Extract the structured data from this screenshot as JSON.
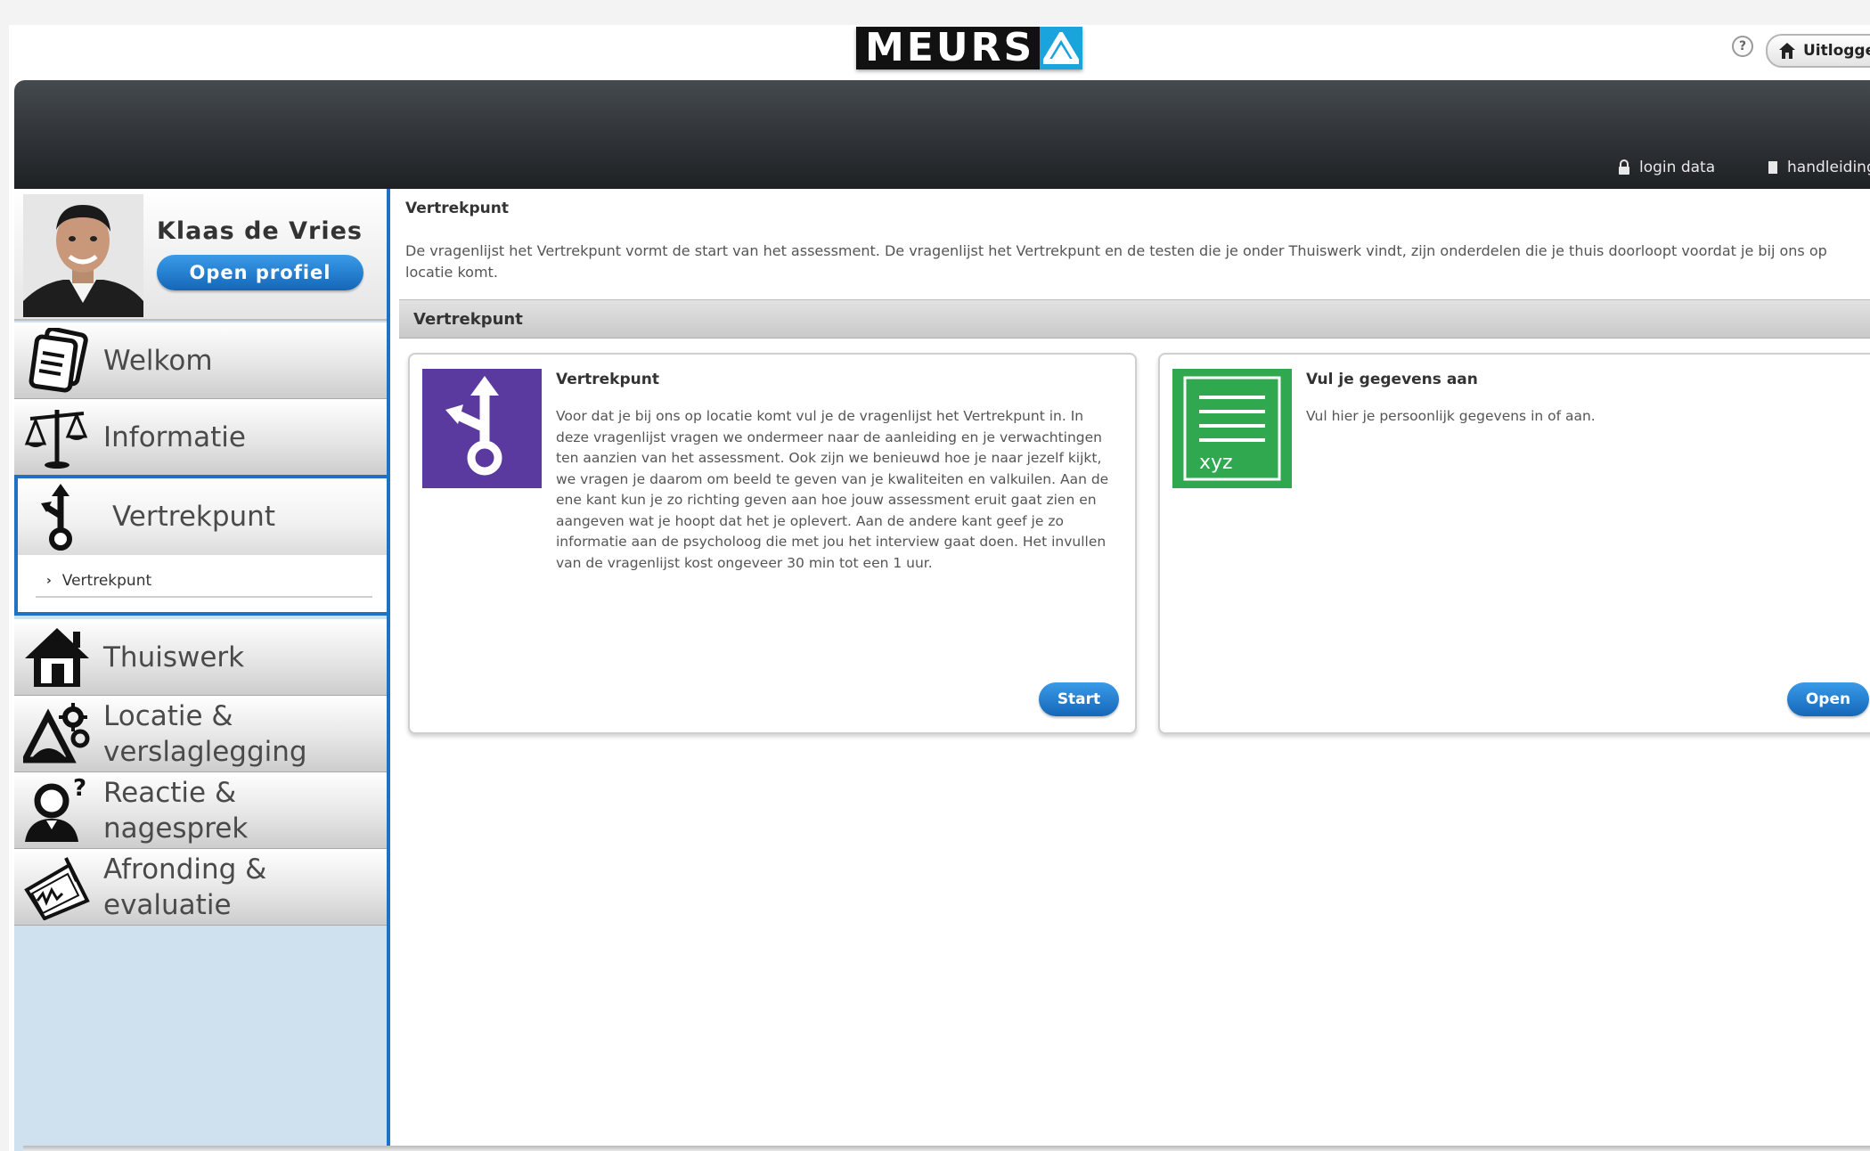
{
  "header": {
    "logo_text": "MEURS",
    "help_glyph": "?",
    "logout_label": "Uitloggen",
    "colors": {
      "logo_accent": "#1aa3dc",
      "topbar": "#2f3337",
      "accent_blue": "#1f71c2"
    }
  },
  "topbar": {
    "links": [
      {
        "label": "login data",
        "icon": "lock-icon"
      },
      {
        "label": "handleiding",
        "icon": "document-icon"
      }
    ]
  },
  "profile": {
    "name": "Klaas de  Vries",
    "button_label": "Open profiel"
  },
  "sidebar": {
    "items": [
      {
        "label": "Welkom",
        "icon": "documents-icon"
      },
      {
        "label": "Informatie",
        "icon": "scales-icon"
      },
      {
        "label": "Vertrekpunt",
        "icon": "signpost-icon"
      },
      {
        "label": "Thuiswerk",
        "icon": "house-icon"
      },
      {
        "label": "Locatie & verslaglegging",
        "icon": "location-gear-icon"
      },
      {
        "label": "Reactie & nagesprek",
        "icon": "person-question-icon"
      },
      {
        "label": "Afronding & evaluatie",
        "icon": "signed-paper-icon"
      }
    ],
    "active_sub_item": "Vertrekpunt"
  },
  "main": {
    "title": "Vertrekpunt",
    "intro": "De vragenlijst het Vertrekpunt vormt de start van het assessment. De vragenlijst het Vertrekpunt en de testen die je onder Thuiswerk vindt, zijn onderdelen die je thuis doorloopt voordat je bij ons op locatie komt.",
    "section_title": "Vertrekpunt",
    "cards": [
      {
        "title": "Vertrekpunt",
        "description": "Voor dat je bij ons op locatie komt vul je de vragenlijst het Vertrekpunt in. In deze vragenlijst vragen we ondermeer naar de aanleiding en je verwachtingen ten aanzien van het assessment. Ook zijn we benieuwd hoe je naar jezelf kijkt, we vragen je daarom om beeld te geven van je kwaliteiten en valkuilen. Aan de ene kant kun je zo richting geven aan hoe jouw assessment eruit gaat zien en aangeven wat je hoopt dat het je oplevert. Aan de andere kant geef je zo informatie aan de psycholoog die met jou het interview gaat doen. Het invullen van de vragenlijst kost ongeveer 30 min tot een 1 uur.",
        "button_label": "Start",
        "icon_color": "#5b3aa0"
      },
      {
        "title": "Vul je gegevens aan",
        "description": "Vul hier je persoonlijk gegevens in of aan.",
        "button_label": "Open",
        "thumb_text": "xyz",
        "icon_color": "#2fa84f"
      }
    ]
  }
}
